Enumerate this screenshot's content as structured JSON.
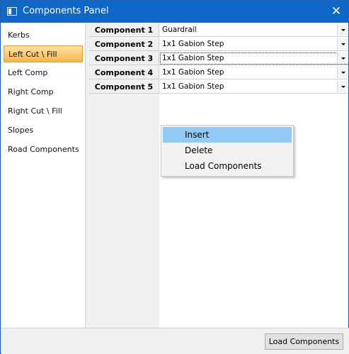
{
  "window": {
    "title": "Components Panel",
    "close_label": "✕"
  },
  "sidebar": {
    "items": [
      {
        "label": "Kerbs"
      },
      {
        "label": "Left Cut \\ Fill"
      },
      {
        "label": "Left Comp"
      },
      {
        "label": "Right Comp"
      },
      {
        "label": "Right Cut \\ Fill"
      },
      {
        "label": "Slopes"
      },
      {
        "label": "Road Components"
      }
    ],
    "selected": "Left Cut \\ Fill"
  },
  "grid": {
    "rows": [
      {
        "label": "Component 1",
        "value": "Guardrail"
      },
      {
        "label": "Component 2",
        "value": "1x1 Gabion Step"
      },
      {
        "label": "Component 3",
        "value": "1x1 Gabion Step"
      },
      {
        "label": "Component 4",
        "value": "1x1 Gabion Step"
      },
      {
        "label": "Component 5",
        "value": "1x1 Gabion Step"
      }
    ]
  },
  "context_menu": {
    "items": [
      {
        "label": "Insert"
      },
      {
        "label": "Delete"
      },
      {
        "label": "Load Components"
      }
    ],
    "highlighted": "Insert"
  },
  "footer": {
    "load_button_label": "Load Components"
  },
  "colors": {
    "titlebar": "#0f67c8",
    "selection": "#f8b64a",
    "menu_highlight": "#91c9f7"
  }
}
